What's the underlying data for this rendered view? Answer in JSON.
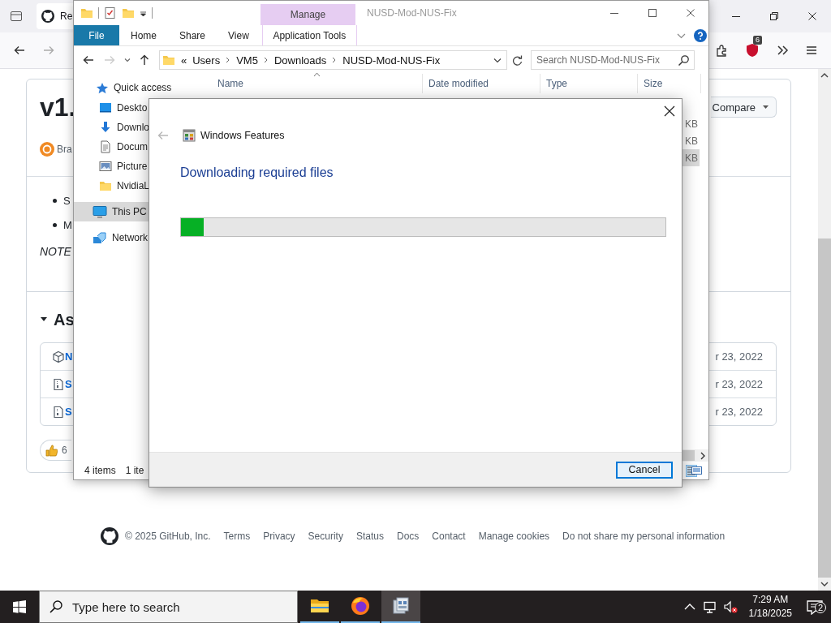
{
  "browser": {
    "tab_title": "Re",
    "extension_badge": "6"
  },
  "release": {
    "title": "v1.",
    "compare_button": "Compare",
    "author": "Bra",
    "bullets": [
      "S",
      "M"
    ],
    "note": "NOTE",
    "assets_heading": "As",
    "assets_expanded": true,
    "assets": [
      {
        "kind": "package",
        "name": "N",
        "date": "r 23, 2022"
      },
      {
        "kind": "archive",
        "name": "S",
        "date": "r 23, 2022"
      },
      {
        "kind": "archive",
        "name": "S",
        "date": "r 23, 2022"
      }
    ],
    "reaction_count": "6"
  },
  "footer": {
    "copyright": "© 2025 GitHub, Inc.",
    "links": [
      "Terms",
      "Privacy",
      "Security",
      "Status",
      "Docs",
      "Contact",
      "Manage cookies",
      "Do not share my personal information"
    ]
  },
  "explorer": {
    "title": "NUSD-Mod-NUS-Fix",
    "tab_group": "Manage",
    "ribbon_tabs": [
      {
        "label": "File",
        "kind": "file"
      },
      {
        "label": "Home",
        "kind": "plain"
      },
      {
        "label": "Share",
        "kind": "plain"
      },
      {
        "label": "View",
        "kind": "plain"
      },
      {
        "label": "Application Tools",
        "kind": "contextual"
      }
    ],
    "path_overflow": "«",
    "path": [
      "Users",
      "VM5",
      "Downloads",
      "NUSD-Mod-NUS-Fix"
    ],
    "search_placeholder": "Search NUSD-Mod-NUS-Fix",
    "columns": [
      {
        "label": "Name",
        "sorted": true
      },
      {
        "label": "Date modified",
        "sorted": false
      },
      {
        "label": "Type",
        "sorted": false
      },
      {
        "label": "Size",
        "sorted": false
      }
    ],
    "nav": [
      {
        "label": "Quick access",
        "kind": "star",
        "selected": false,
        "children": [
          {
            "label": "Deskto",
            "kind": "desktop",
            "selected": false
          },
          {
            "label": "Downlo",
            "kind": "download",
            "selected": false
          },
          {
            "label": "Docum",
            "kind": "document",
            "selected": false
          },
          {
            "label": "Picture",
            "kind": "pictures",
            "selected": false
          },
          {
            "label": "NvidiaL",
            "kind": "folder",
            "selected": false
          }
        ]
      },
      {
        "label": "This PC",
        "kind": "computer",
        "selected": true
      },
      {
        "label": "Network",
        "kind": "network",
        "selected": false
      }
    ],
    "files": [
      {
        "size": "KB",
        "selected": false
      },
      {
        "size": "KB",
        "selected": false
      },
      {
        "size": "KB",
        "selected": true
      }
    ],
    "status_items": "4 items",
    "status_selected": "1 ite"
  },
  "dialog": {
    "title": "Windows Features",
    "back_disabled": true,
    "heading": "Downloading required files",
    "progress": {
      "level": 0.047
    },
    "cancel_button": "Cancel"
  },
  "taskbar": {
    "search_placeholder": "Type here to search",
    "apps": [
      {
        "kind": "folder",
        "selected": false
      },
      {
        "kind": "browser",
        "selected": false
      },
      {
        "kind": "features",
        "selected": true
      }
    ],
    "volume_muted": true,
    "time": "7:29 AM",
    "date": "1/18/2025",
    "notifications": "2"
  }
}
